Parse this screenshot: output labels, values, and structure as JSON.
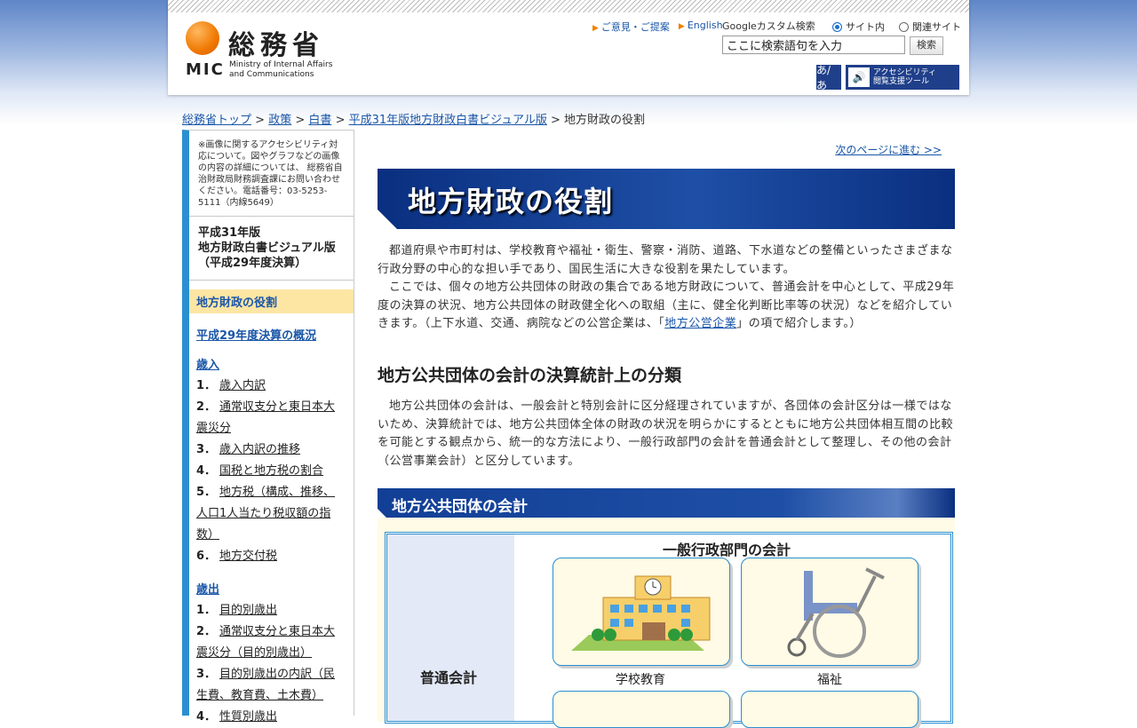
{
  "header": {
    "logo_jp": "総務省",
    "logo_mic": "MIC",
    "logo_en_line1": "Ministry of Internal Affairs",
    "logo_en_line2": "and Communications",
    "links": [
      {
        "label": "ご意見・ご提案"
      },
      {
        "label": "English"
      }
    ],
    "google_label": "Googleカスタム検索",
    "radio_site": "サイト内",
    "radio_related": "関連サイト",
    "search_value": "ここに検索語句を入力",
    "search_button": "検索",
    "a11y_font_label": "あ/あ",
    "a11y_tool_line1": "アクセシビリティ",
    "a11y_tool_line2": "閲覧支援ツール"
  },
  "breadcrumb": {
    "items": [
      "総務省トップ",
      "政策",
      "白書",
      "平成31年版地方財政白書ビジュアル版"
    ],
    "current": "地方財政の役割",
    "sep": ">"
  },
  "sidebar": {
    "note": "※画像に関するアクセシビリティ対応について。図やグラフなどの画像の内容の詳細については、 総務省自治財政局財務調査課にお問い合わせください。電話番号：03-5253-5111（内線5649）",
    "title_line1": "平成31年版",
    "title_line2": "地方財政白書ビジュアル版",
    "title_line3": "（平成29年度決算）",
    "current": "地方財政の役割",
    "overview": "平成29年度決算の概況",
    "revenue_heading": "歳入",
    "revenue_items": [
      {
        "num": "1．",
        "label": "歳入内訳"
      },
      {
        "num": "2．",
        "label": "通常収支分と東日本大震災分"
      },
      {
        "num": "3．",
        "label": "歳入内訳の推移"
      },
      {
        "num": "4．",
        "label": "国税と地方税の割合"
      },
      {
        "num": "5．",
        "label": "地方税（構成、推移、人口1人当たり税収額の指数）"
      },
      {
        "num": "6．",
        "label": "地方交付税"
      }
    ],
    "expenditure_heading": "歳出",
    "expenditure_items": [
      {
        "num": "1．",
        "label": "目的別歳出"
      },
      {
        "num": "2．",
        "label": "通常収支分と東日本大震災分（目的別歳出）"
      },
      {
        "num": "3．",
        "label": "目的別歳出の内訳（民生費、教育費、土木費）"
      },
      {
        "num": "4．",
        "label": "性質別歳出"
      }
    ]
  },
  "main": {
    "next_link": "次のページに進む >>",
    "banner_title": "地方財政の役割",
    "intro_p1": "都道府県や市町村は、学校教育や福祉・衛生、警察・消防、道路、下水道などの整備といったさまざまな行政分野の中心的な担い手であり、国民生活に大きな役割を果たしています。",
    "intro_p2_a": "ここでは、個々の地方公共団体の財政の集合である地方財政について、普通会計を中心として、平成29年度の決算の状況、地方公共団体の財政健全化への取組（主に、健全化判断比率等の状況）などを紹介していきます。（上下水道、交通、病院などの公営企業は、「",
    "intro_p2_link": "地方公営企業",
    "intro_p2_b": "」の項で紹介します。）",
    "section_title": "地方公共団体の会計の決算統計上の分類",
    "section_p": "地方公共団体の会計は、一般会計と特別会計に区分経理されていますが、各団体の会計区分は一様ではないため、決算統計では、地方公共団体全体の財政の状況を明らかにするとともに地方公共団体相互間の比較を可能とする観点から、統一的な方法により、一般行政部門の会計を普通会計として整理し、その他の会計（公営事業会計）と区分しています。",
    "diagram_bar_title": "地方公共団体の会計",
    "diagram_left_label": "普通会計",
    "diagram_head": "一般行政部門の会計",
    "card1_caption": "学校教育",
    "card2_caption": "福祉"
  }
}
